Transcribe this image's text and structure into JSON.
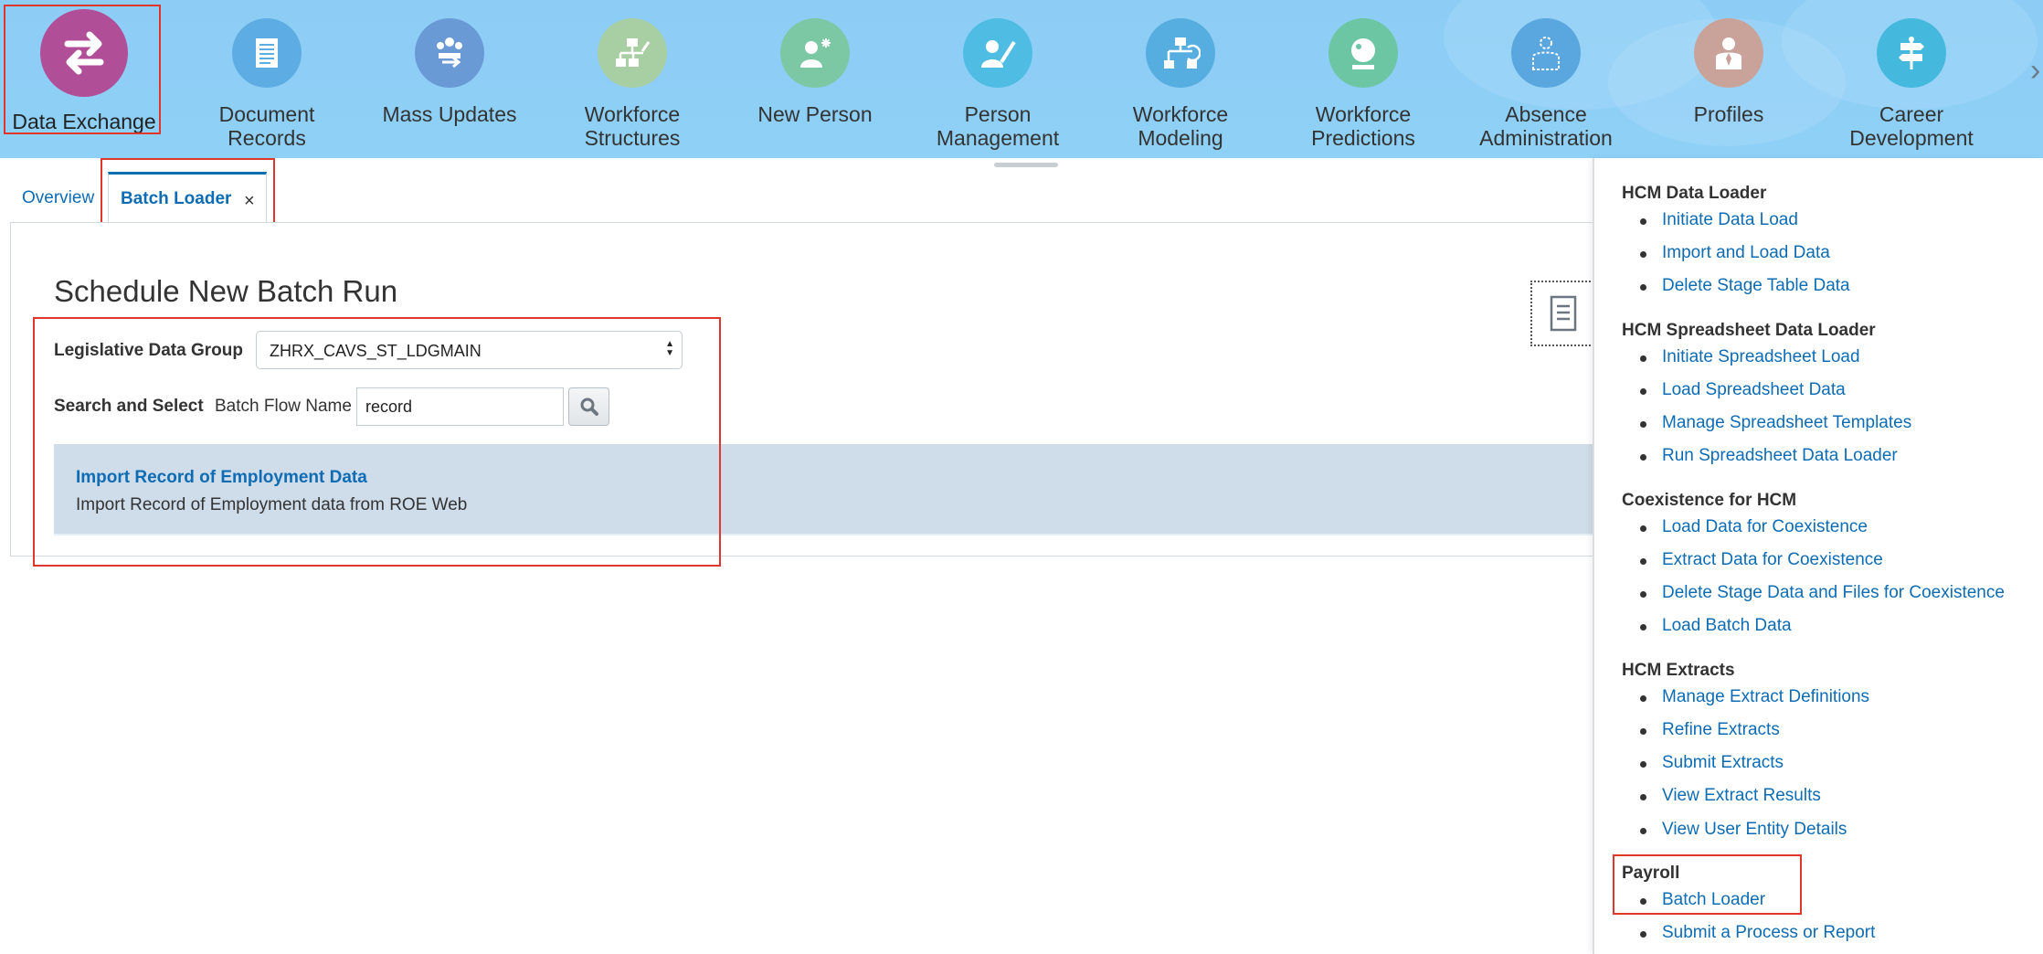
{
  "springboard": {
    "items": [
      {
        "label": "Data Exchange",
        "icon": "data-exchange-icon",
        "color": "#b04f97"
      },
      {
        "label": "Document Records",
        "icon": "document-records-icon",
        "color": "#5dace3"
      },
      {
        "label": "Mass Updates",
        "icon": "mass-updates-icon",
        "color": "#6a9ad6"
      },
      {
        "label": "Workforce\nStructures",
        "icon": "workforce-structures-icon",
        "color": "#a8cfa3"
      },
      {
        "label": "New Person",
        "icon": "new-person-icon",
        "color": "#7cc8a5"
      },
      {
        "label": "Person\nManagement",
        "icon": "person-management-icon",
        "color": "#4fbde3"
      },
      {
        "label": "Workforce\nModeling",
        "icon": "workforce-modeling-icon",
        "color": "#56aee0"
      },
      {
        "label": "Workforce\nPredictions",
        "icon": "workforce-predictions-icon",
        "color": "#6cc6a3"
      },
      {
        "label": "Absence\nAdministration",
        "icon": "absence-administration-icon",
        "color": "#5aa6df"
      },
      {
        "label": "Profiles",
        "icon": "profiles-icon",
        "color": "#c9a39a"
      },
      {
        "label": "Career\nDevelopment",
        "icon": "career-development-icon",
        "color": "#45b8de"
      }
    ],
    "next_icon": "chevron-right-icon"
  },
  "tabs": {
    "overview": "Overview",
    "batch_loader": "Batch Loader",
    "close": "×"
  },
  "main": {
    "title": "Schedule New Batch Run",
    "ldg_label": "Legislative Data Group",
    "ldg_value": "ZHRX_CAVS_ST_LDGMAIN",
    "search_select_label": "Search and Select",
    "batch_flow_label": "Batch Flow Name",
    "batch_flow_value": "record",
    "result": {
      "title": "Import Record of Employment Data",
      "description": "Import Record of Employment data from ROE Web"
    }
  },
  "tasks": {
    "sections": [
      {
        "heading": "HCM Data Loader",
        "links": [
          "Initiate Data Load",
          "Import and Load Data",
          "Delete Stage Table Data"
        ]
      },
      {
        "heading": "HCM Spreadsheet Data Loader",
        "links": [
          "Initiate Spreadsheet Load",
          "Load Spreadsheet Data",
          "Manage Spreadsheet Templates",
          "Run Spreadsheet Data Loader"
        ]
      },
      {
        "heading": "Coexistence for HCM",
        "links": [
          "Load Data for Coexistence",
          "Extract Data for Coexistence",
          "Delete Stage Data and Files for Coexistence",
          "Load Batch Data"
        ]
      },
      {
        "heading": "HCM Extracts",
        "links": [
          "Manage Extract Definitions",
          "Refine Extracts",
          "Submit Extracts",
          "View Extract Results",
          "View User Entity Details"
        ]
      },
      {
        "heading": "Payroll",
        "links": [
          "Batch Loader",
          "Submit a Process or Report"
        ]
      }
    ]
  },
  "colors": {
    "accent": "#0e6cb4",
    "highlight": "#e0372c",
    "springboard_bg": "#8dcdf5"
  }
}
